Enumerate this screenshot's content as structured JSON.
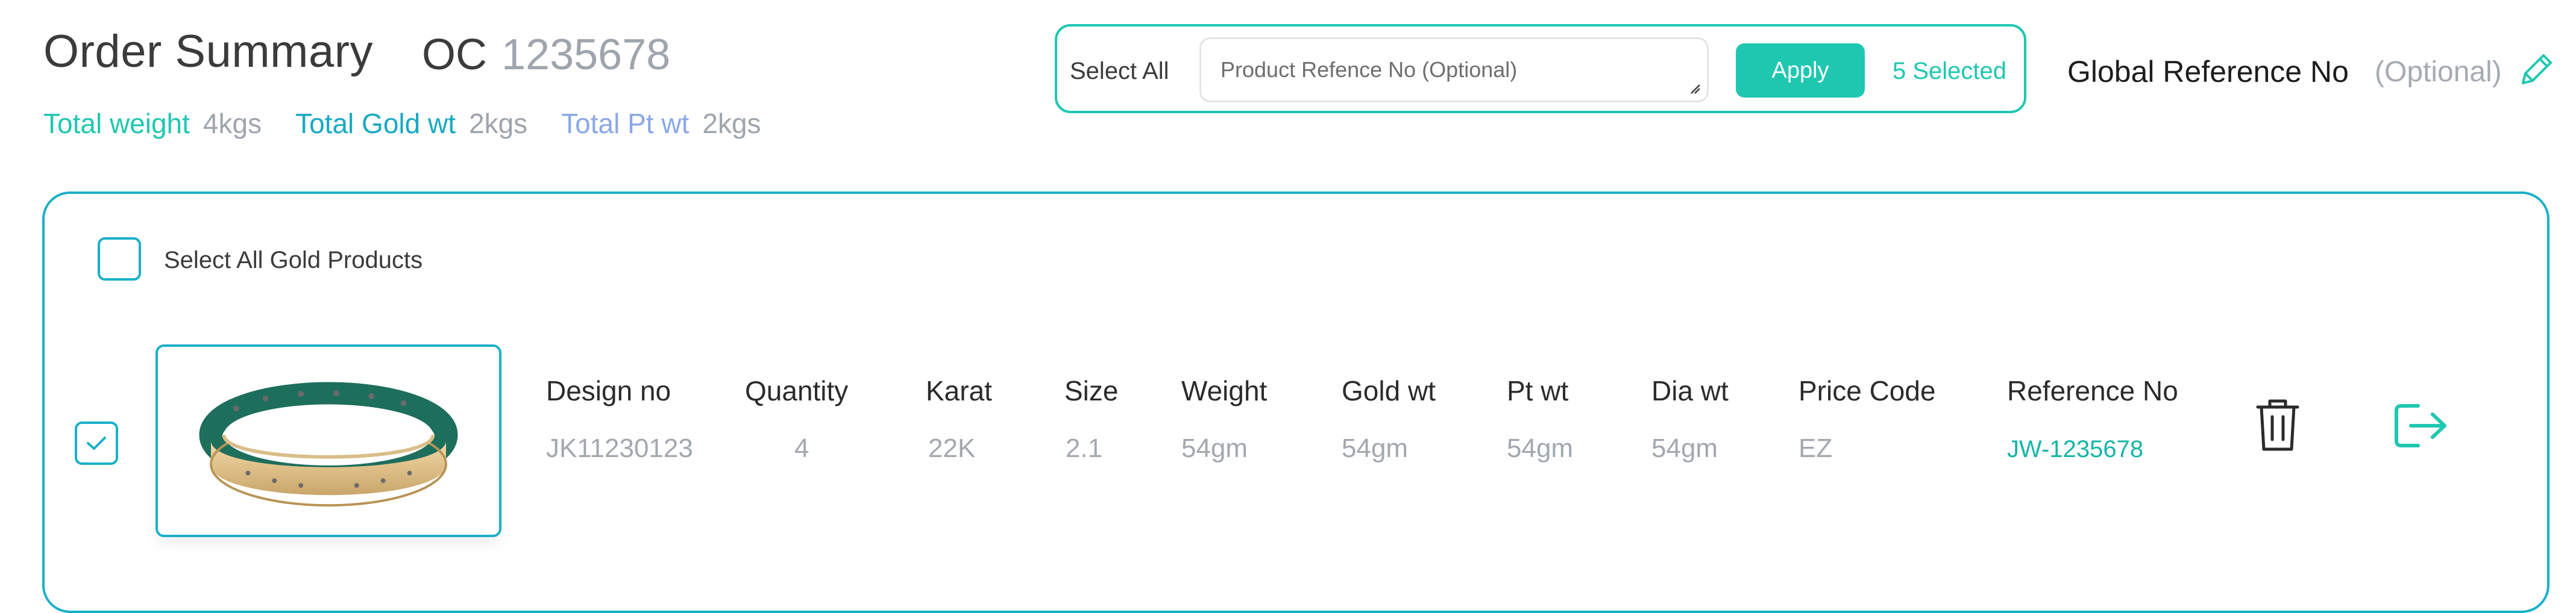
{
  "header": {
    "title": "Order Summary",
    "order_code_label": "OC",
    "order_code_value": "1235678"
  },
  "metrics": [
    {
      "label": "Total weight",
      "value": "4kgs",
      "color": "#1fc7b0"
    },
    {
      "label": "Total Gold wt",
      "value": "2kgs",
      "color": "#17a9c4"
    },
    {
      "label": "Total Pt wt",
      "value": "2kgs",
      "color": "#8aa8e8"
    }
  ],
  "reference_panel": {
    "select_all_label": "Select All",
    "input_placeholder": "Product Refence No (Optional)",
    "apply_label": "Apply",
    "selected_count_text": "5 Selected"
  },
  "global_reference": {
    "label": "Global Reference No",
    "optional_text": "(Optional)",
    "edit_icon": "pencil-icon"
  },
  "products": {
    "select_all_label": "Select All Gold Products",
    "select_all_checked": false,
    "columns": [
      "Design no",
      "Quantity",
      "Karat",
      "Size",
      "Weight",
      "Gold wt",
      "Pt wt",
      "Dia wt",
      "Price Code",
      "Reference No"
    ],
    "rows": [
      {
        "checked": true,
        "image_icon": "bangle-image",
        "design_no": "JK11230123",
        "quantity": "4",
        "karat": "22K",
        "size": "2.1",
        "weight": "54gm",
        "gold_wt": "54gm",
        "pt_wt": "54gm",
        "dia_wt": "54gm",
        "price_code": "EZ",
        "reference_no": "JW-1235678",
        "actions": [
          "trash-icon",
          "exit-icon"
        ]
      }
    ]
  },
  "colors": {
    "accent_teal": "#1fc7b0",
    "accent_blue": "#1ab0c9",
    "muted_text": "#a3a8ae"
  }
}
